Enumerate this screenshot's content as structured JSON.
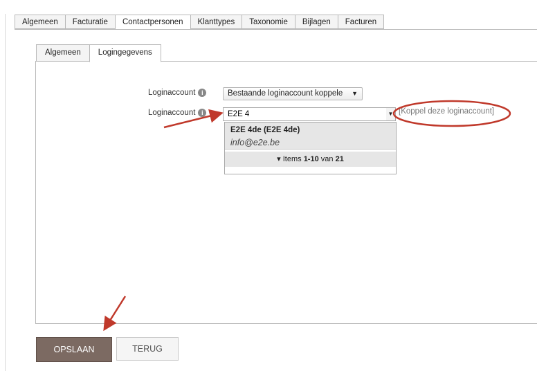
{
  "outer_tabs": [
    "Algemeen",
    "Facturatie",
    "Contactpersonen",
    "Klanttypes",
    "Taxonomie",
    "Bijlagen",
    "Facturen"
  ],
  "inner_tabs": [
    "Algemeen",
    "Logingegevens"
  ],
  "form": {
    "label1": "Loginaccount",
    "label2": "Loginaccount",
    "select_value": "Bestaande loginaccount koppele",
    "input_value": "E2E 4",
    "link": "[Koppel deze loginaccount]"
  },
  "dropdown": {
    "name": "E2E 4de (E2E 4de)",
    "email": "info@e2e.be",
    "paging_prefix": "Items ",
    "paging_range": "1-10",
    "paging_mid": " van ",
    "paging_total": "21"
  },
  "buttons": {
    "save": "OPSLAAN",
    "back": "TERUG"
  },
  "colors": {
    "annotation": "#c0392b",
    "save_bg": "#7c6a62"
  }
}
